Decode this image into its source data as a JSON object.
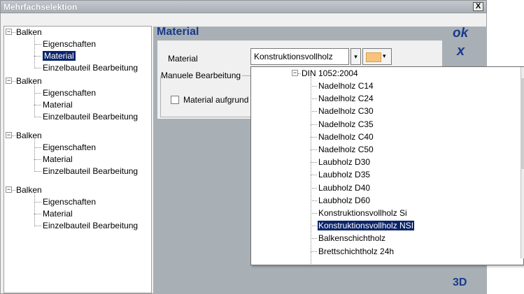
{
  "window": {
    "title": "Mehrfachselektion",
    "close_label": "X"
  },
  "tree": {
    "groups": [
      {
        "label": "Balken",
        "expander": "−",
        "children": [
          "Eigenschaften",
          "Material",
          "Einzelbauteil Bearbeitung"
        ]
      },
      {
        "label": "Balken",
        "expander": "−",
        "children": [
          "Eigenschaften",
          "Material",
          "Einzelbauteil Bearbeitung"
        ]
      },
      {
        "label": "Balken",
        "expander": "−",
        "children": [
          "Eigenschaften",
          "Material",
          "Einzelbauteil Bearbeitung"
        ]
      },
      {
        "label": "Balken",
        "expander": "−",
        "children": [
          "Eigenschaften",
          "Material",
          "Einzelbauteil Bearbeitung"
        ]
      }
    ],
    "selected": "Material"
  },
  "panel": {
    "title": "Material",
    "ok_label": "ok",
    "cancel_label": "x",
    "btn_3d_label": "3D",
    "material_label": "Material",
    "combo_value": "Konstruktionsvollholz",
    "combo_arrow": "▾",
    "color_arrow": "▾",
    "group_label": "Manuele Bearbeitung",
    "checkbox_label": "Material aufgrund",
    "swatch_color": "#f8c37a"
  },
  "dropdown": {
    "expander": "−",
    "root": "DIN 1052:2004",
    "items": [
      "Nadelholz C14",
      "Nadelholz C24",
      "Nadelholz C30",
      "Nadelholz C35",
      "Nadelholz C40",
      "Nadelholz C50",
      "Laubholz D30",
      "Laubholz D35",
      "Laubholz D40",
      "Laubholz D60",
      "Konstruktionsvollholz Si",
      "Konstruktionsvollholz NSI",
      "Balkenschichtholz",
      "Brettschichtholz 24h"
    ],
    "selected_index": 11
  },
  "colors": {
    "accent": "#1a3a8a",
    "panel_bg": "#a8b0b6",
    "selection": "#0a246a"
  }
}
